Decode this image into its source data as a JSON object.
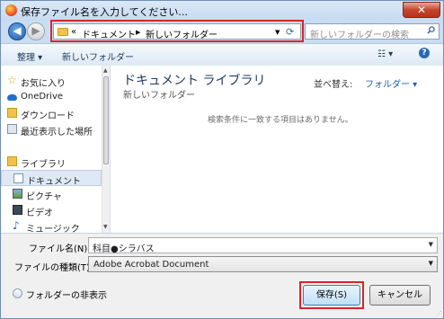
{
  "window": {
    "title": "保存ファイル名を入力してください...",
    "close_label": "✕"
  },
  "nav": {
    "breadcrumb": [
      "ドキュメント",
      "新しいフォルダー"
    ],
    "overflow": "«",
    "search_placeholder": "新しいフォルダーの検索"
  },
  "toolbar": {
    "organize_label": "整理 ▾",
    "new_folder_label": "新しいフォルダー",
    "view_label": "☷ ▾",
    "help_label": "?"
  },
  "sidebar": {
    "items": [
      {
        "label": "お気に入り",
        "icon": "star-icon"
      },
      {
        "label": "OneDrive",
        "icon": "cloud-icon"
      },
      {
        "label": "ダウンロード",
        "icon": "download-icon"
      },
      {
        "label": "最近表示した場所",
        "icon": "recent-places-icon"
      },
      {
        "label": "ライブラリ",
        "icon": "library-icon"
      },
      {
        "label": "ドキュメント",
        "icon": "documents-icon",
        "selected": true
      },
      {
        "label": "ピクチャ",
        "icon": "pictures-icon"
      },
      {
        "label": "ビデオ",
        "icon": "video-icon"
      },
      {
        "label": "ミュージック",
        "icon": "music-icon"
      }
    ]
  },
  "main": {
    "library_title": "ドキュメント ライブラリ",
    "library_subtitle": "新しいフォルダー",
    "arrange_label": "並べ替え:",
    "arrange_value": "フォルダー ▾",
    "empty_message": "検索条件に一致する項目はありません。"
  },
  "form": {
    "filename_label": "ファイル名(N):",
    "filename_value": "科目●シラバス",
    "filetype_label": "ファイルの種類(T):",
    "filetype_value": "Adobe Acrobat Document",
    "hide_folders_label": "フォルダーの非表示",
    "save_label": "保存(S)",
    "cancel_label": "キャンセル"
  },
  "colors": {
    "highlight": "#d6262b",
    "title_bar": "#c6daf1",
    "accent": "#1f5fae"
  }
}
